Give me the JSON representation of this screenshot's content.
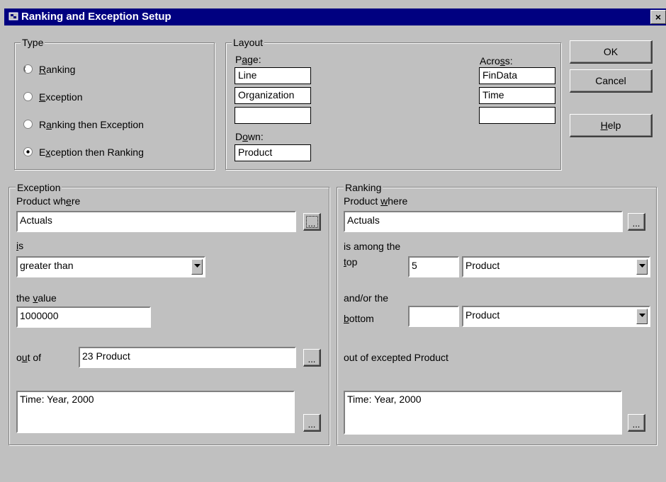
{
  "window": {
    "title": "Ranking and Exception Setup",
    "close_label": "×"
  },
  "type_group": {
    "legend": "Type",
    "options": [
      {
        "pre": "",
        "key": "R",
        "post": "anking",
        "selected": false
      },
      {
        "pre": "",
        "key": "E",
        "post": "xception",
        "selected": false
      },
      {
        "pre": "R",
        "key": "a",
        "post": "nking then Exception",
        "selected": false
      },
      {
        "pre": "E",
        "key": "x",
        "post": "ception then Ranking",
        "selected": true
      }
    ]
  },
  "layout_group": {
    "legend": "Layout",
    "page_label_pre": "P",
    "page_label_key": "a",
    "page_label_post": "ge:",
    "page_values": [
      "Line",
      "Organization",
      ""
    ],
    "down_label_pre": "D",
    "down_label_key": "o",
    "down_label_post": "wn:",
    "down_value": "Product",
    "across_label_pre": "Acro",
    "across_label_key": "s",
    "across_label_post": "s:",
    "across_values": [
      "FinData",
      "Time",
      ""
    ]
  },
  "buttons": {
    "ok": "OK",
    "cancel": "Cancel",
    "help_key": "H",
    "help_post": "elp",
    "ellipsis": "..."
  },
  "exception_group": {
    "legend": "Exception",
    "where_pre": "Product wh",
    "where_key": "e",
    "where_post": "re",
    "where_value": "Actuals",
    "is_key": "i",
    "is_post": "s",
    "comparison_value": "greater than",
    "value_pre": "the ",
    "value_key": "v",
    "value_post": "alue",
    "threshold_value": "1000000",
    "outof_pre": "o",
    "outof_key": "u",
    "outof_post": "t of",
    "outof_value": "23 Product",
    "context_value": "Time: Year, 2000"
  },
  "ranking_group": {
    "legend": "Ranking",
    "where_pre": "Product ",
    "where_key": "w",
    "where_post": "here",
    "where_value": "Actuals",
    "among_label": "is among the",
    "top_key": "t",
    "top_post": "op",
    "top_value": "5",
    "top_dimension": "Product",
    "andor_label": "and/or the",
    "bottom_key": "b",
    "bottom_post": "ottom",
    "bottom_value": "",
    "bottom_dimension": "Product",
    "outof_label": "out of excepted Product",
    "context_value": "Time: Year, 2000"
  }
}
